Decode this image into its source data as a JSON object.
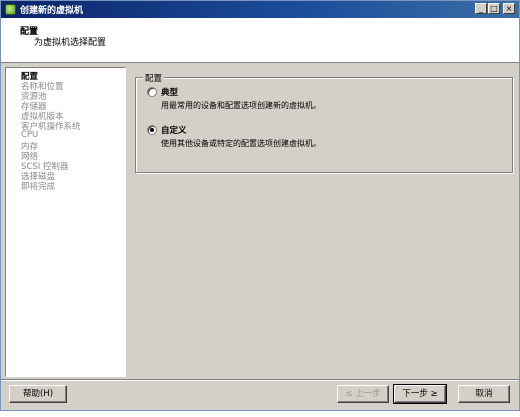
{
  "window": {
    "title": "创建新的虚拟机",
    "minimize_glyph": "_",
    "maximize_glyph": "□",
    "close_glyph": "×"
  },
  "header": {
    "title": "配置",
    "subtitle": "为虚拟机选择配置"
  },
  "sidebar": {
    "items": [
      {
        "label": "配置",
        "active": true
      },
      {
        "label": "名称和位置",
        "active": false
      },
      {
        "label": "资源池",
        "active": false
      },
      {
        "label": "存储器",
        "active": false
      },
      {
        "label": "虚拟机版本",
        "active": false
      },
      {
        "label": "客户机操作系统",
        "active": false
      },
      {
        "label": "CPU",
        "active": false
      },
      {
        "label": "内存",
        "active": false
      },
      {
        "label": "网络",
        "active": false
      },
      {
        "label": "SCSI 控制器",
        "active": false
      },
      {
        "label": "选择磁盘",
        "active": false
      },
      {
        "label": "即将完成",
        "active": false
      }
    ]
  },
  "config_group": {
    "label": "配置",
    "options": [
      {
        "label": "典型",
        "description": "用最常用的设备和配置选项创建新的虚拟机。",
        "selected": false
      },
      {
        "label": "自定义",
        "description": "使用其他设备或特定的配置选项创建虚拟机。",
        "selected": true
      }
    ]
  },
  "footer": {
    "help_label": "帮助(H)",
    "back_label": "≤ 上一步",
    "next_label": "下一步 ≥",
    "cancel_label": "取消"
  }
}
